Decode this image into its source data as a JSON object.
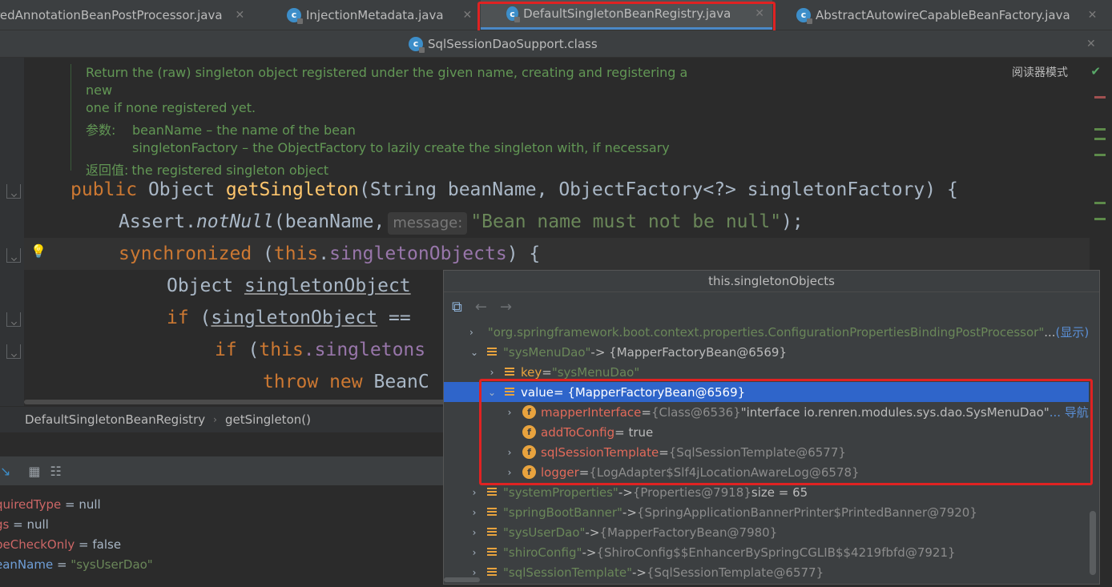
{
  "tabs_row1": [
    {
      "label": "redAnnotationBeanPostProcessor.java",
      "active": false
    },
    {
      "label": "InjectionMetadata.java",
      "active": false
    },
    {
      "label": "DefaultSingletonBeanRegistry.java",
      "active": true
    },
    {
      "label": "AbstractAutowireCapableBeanFactory.java",
      "active": false
    }
  ],
  "tabs_row2": [
    {
      "label": "SqlSessionDaoSupport.class",
      "active": false
    }
  ],
  "reader_mode": "阅读器模式",
  "doc": {
    "line1": "Return the (raw) singleton object registered under the given name, creating and registering a new",
    "line2": "one if none registered yet.",
    "params_label": "参数:",
    "param1": "beanName – the name of the bean",
    "param2": "singletonFactory – the ObjectFactory to lazily create the singleton with, if necessary",
    "returns_label": "返回值:",
    "returns": "the registered singleton object"
  },
  "code": {
    "l1_kw": "public",
    "l1_type": "Object",
    "l1_fn": "getSingleton",
    "l1_rest": "(String beanName, ObjectFactory<?> singletonFactory) {",
    "l2_a": "Assert.",
    "l2_fn": "notNull",
    "l2_b": "(beanName,",
    "l2_hint": "message:",
    "l2_str": "\"Bean name must not be null\"",
    "l2_end": ");",
    "l3_kw": "synchronized",
    "l3_a": " (",
    "l3_this": "this",
    "l3_dot": ".",
    "l3_fld": "singletonObjects",
    "l3_end": ") {",
    "l4_a": "Object ",
    "l4_var": "singletonObject",
    "l5_kw": "if",
    "l5_a": " (",
    "l5_var": "singletonObject",
    "l5_b": " ==",
    "l6_kw": "if",
    "l6_a": " (",
    "l6_this": "this",
    "l6_fld": ".singletons",
    "l7_kw": "throw new",
    "l7_a": " BeanC"
  },
  "breadcrumb": [
    "DefaultSingletonBeanRegistry",
    "getSingleton()"
  ],
  "variables": [
    {
      "name": "quiredType",
      "value": " = null",
      "partial": true
    },
    {
      "name": "gs",
      "value": " = null"
    },
    {
      "name": "peCheckOnly",
      "value": " = false"
    },
    {
      "name": "eanName",
      "value": " = \"sysUserDao\"",
      "blue": true
    }
  ],
  "popup": {
    "title": "this.singletonObjects",
    "rows": [
      {
        "indent": 0,
        "arrow": "›",
        "icon": "bars",
        "key": "\"org.springframework.boot.context.properties.ConfigurationPropertiesBindingPostProcessor\"",
        "keystyle": "str",
        "val": " ...",
        "link": "(显示)"
      },
      {
        "indent": 0,
        "arrow": "⌄",
        "icon": "bars",
        "key": "\"sysMenuDao\"",
        "keystyle": "str",
        "val": " -> {MapperFactoryBean@6569}"
      },
      {
        "indent": 1,
        "arrow": "›",
        "icon": "bars",
        "key": "key",
        "keystyle": "key",
        "val": " = ",
        "val2": "\"sysMenuDao\""
      },
      {
        "indent": 1,
        "arrow": "⌄",
        "icon": "bars",
        "key": "value",
        "keystyle": "key",
        "val": " = {MapperFactoryBean@6569}",
        "selected": true
      },
      {
        "indent": 2,
        "arrow": "›",
        "icon": "f",
        "key": "mapperInterface",
        "keystyle": "red",
        "val": " = ",
        "gray": "{Class@6536} ",
        "val2": "\"interface io.renren.modules.sys.dao.SysMenuDao\"",
        "link": " ... 导航"
      },
      {
        "indent": 2,
        "arrow": "",
        "icon": "f",
        "key": "addToConfig",
        "keystyle": "red",
        "val": " = true"
      },
      {
        "indent": 2,
        "arrow": "›",
        "icon": "f",
        "key": "sqlSessionTemplate",
        "keystyle": "red",
        "val": " = ",
        "gray": "{SqlSessionTemplate@6577}"
      },
      {
        "indent": 2,
        "arrow": "›",
        "icon": "f",
        "key": "logger",
        "keystyle": "red",
        "val": " = ",
        "gray": "{LogAdapter$Slf4jLocationAwareLog@6578}"
      },
      {
        "indent": 0,
        "arrow": "›",
        "icon": "bars",
        "key": "\"systemProperties\"",
        "keystyle": "str",
        "val": " -> ",
        "gray": "{Properties@7918} ",
        "val3": " size = 65"
      },
      {
        "indent": 0,
        "arrow": "›",
        "icon": "bars",
        "key": "\"springBootBanner\"",
        "keystyle": "str",
        "val": " -> ",
        "gray": "{SpringApplicationBannerPrinter$PrintedBanner@7920}"
      },
      {
        "indent": 0,
        "arrow": "›",
        "icon": "bars",
        "key": "\"sysUserDao\"",
        "keystyle": "str",
        "val": " -> ",
        "gray": "{MapperFactoryBean@7980}"
      },
      {
        "indent": 0,
        "arrow": "›",
        "icon": "bars",
        "key": "\"shiroConfig\"",
        "keystyle": "str",
        "val": " -> ",
        "gray": "{ShiroConfig$$EnhancerBySpringCGLIB$$4219fbfd@7921}"
      },
      {
        "indent": 0,
        "arrow": "›",
        "icon": "bars",
        "key": "\"sqlSessionTemplate\"",
        "keystyle": "str",
        "val": " -> ",
        "gray": "{SqlSessionTemplate@6577}"
      }
    ]
  },
  "colors": {
    "accent": "#2f65ca",
    "highlight_box": "#e02222"
  }
}
